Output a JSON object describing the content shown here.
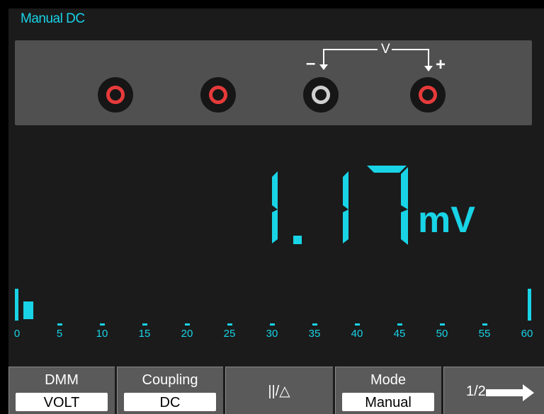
{
  "header": {
    "title": "Manual DC"
  },
  "probe_panel": {
    "label": "V",
    "negative": "–",
    "positive": "+"
  },
  "reading": {
    "digits": "1.17",
    "unit": "mV"
  },
  "bar_scale": {
    "labels": [
      "0",
      "5",
      "10",
      "15",
      "20",
      "25",
      "30",
      "35",
      "40",
      "45",
      "50",
      "55",
      "60"
    ],
    "level": 1.17,
    "max": 60
  },
  "softkeys": {
    "dmm": {
      "title": "DMM",
      "value": "VOLT"
    },
    "coupling": {
      "title": "Coupling",
      "value": "DC"
    },
    "relative": {
      "symbol": "||/△"
    },
    "mode": {
      "title": "Mode",
      "value": "Manual"
    },
    "nav": {
      "page": "1/2"
    }
  },
  "colors": {
    "accent": "#19d3e6",
    "jack_red": "#e63a3a",
    "jack_gray": "#cfcfcf",
    "panel": "#505050"
  }
}
